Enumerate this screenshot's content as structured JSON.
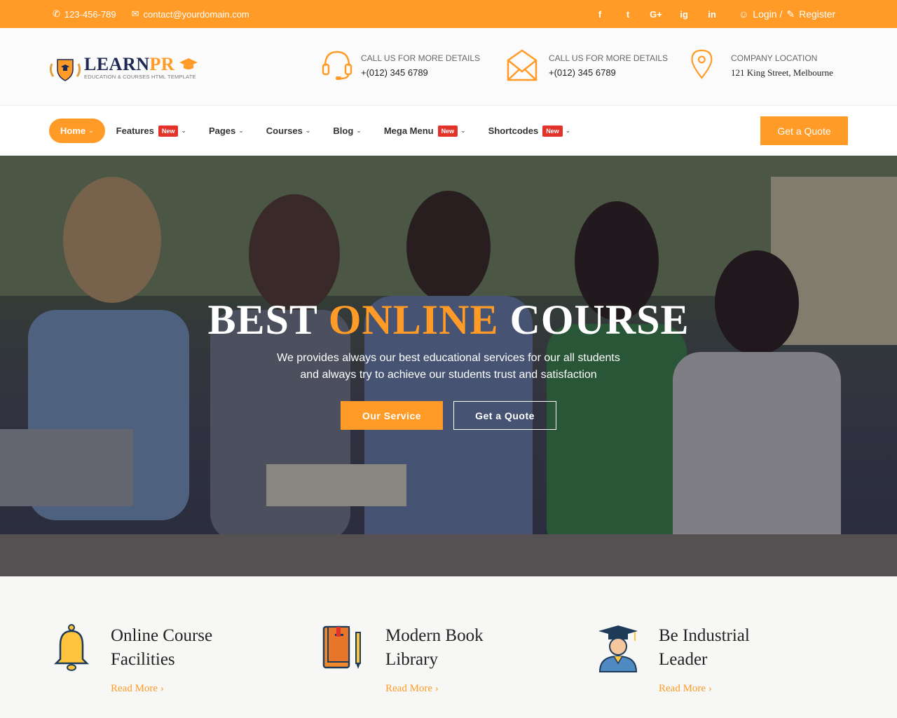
{
  "topbar": {
    "phone": "123-456-789",
    "email": "contact@yourdomain.com",
    "social": [
      "f",
      "t",
      "G+",
      "ig",
      "in"
    ],
    "login_label": "Login /",
    "register_label": "Register"
  },
  "header": {
    "logo_main": "LEARN",
    "logo_accent": "PR",
    "logo_tagline": "EDUCATION & COURSES HTML TEMPLATE",
    "info": [
      {
        "label": "CALL US FOR MORE DETAILS",
        "value": "+(012) 345 6789",
        "icon": "headset-icon"
      },
      {
        "label": "CALL US FOR MORE DETAILS",
        "value": "+(012) 345 6789",
        "icon": "envelope-icon"
      },
      {
        "label": "COMPANY LOCATION",
        "value": "121 King Street, Melbourne",
        "icon": "location-pin-icon"
      }
    ]
  },
  "nav": {
    "items": [
      {
        "label": "Home",
        "badge": ""
      },
      {
        "label": "Features",
        "badge": "New"
      },
      {
        "label": "Pages",
        "badge": ""
      },
      {
        "label": "Courses",
        "badge": ""
      },
      {
        "label": "Blog",
        "badge": ""
      },
      {
        "label": "Mega Menu",
        "badge": "New"
      },
      {
        "label": "Shortcodes",
        "badge": "New"
      }
    ],
    "quote_button": "Get a Quote"
  },
  "hero": {
    "title_part1": "BEST ",
    "title_accent": "ONLINE",
    "title_part2": " COURSE",
    "subtitle_line1": "We provides always our best educational services for our all students",
    "subtitle_line2": "and always try to achieve our students trust and satisfaction",
    "primary_button": "Our Service",
    "secondary_button": "Get a Quote"
  },
  "features": [
    {
      "title_line1": "Online Course",
      "title_line2": "Facilities",
      "link": "Read More",
      "icon": "bell-icon"
    },
    {
      "title_line1": "Modern Book",
      "title_line2": "Library",
      "link": "Read More",
      "icon": "book-icon"
    },
    {
      "title_line1": "Be Industrial",
      "title_line2": "Leader",
      "link": "Read More",
      "icon": "graduate-icon"
    }
  ],
  "colors": {
    "accent": "#ff9b26",
    "navy": "#1f2a52",
    "badge": "#e2322a"
  }
}
